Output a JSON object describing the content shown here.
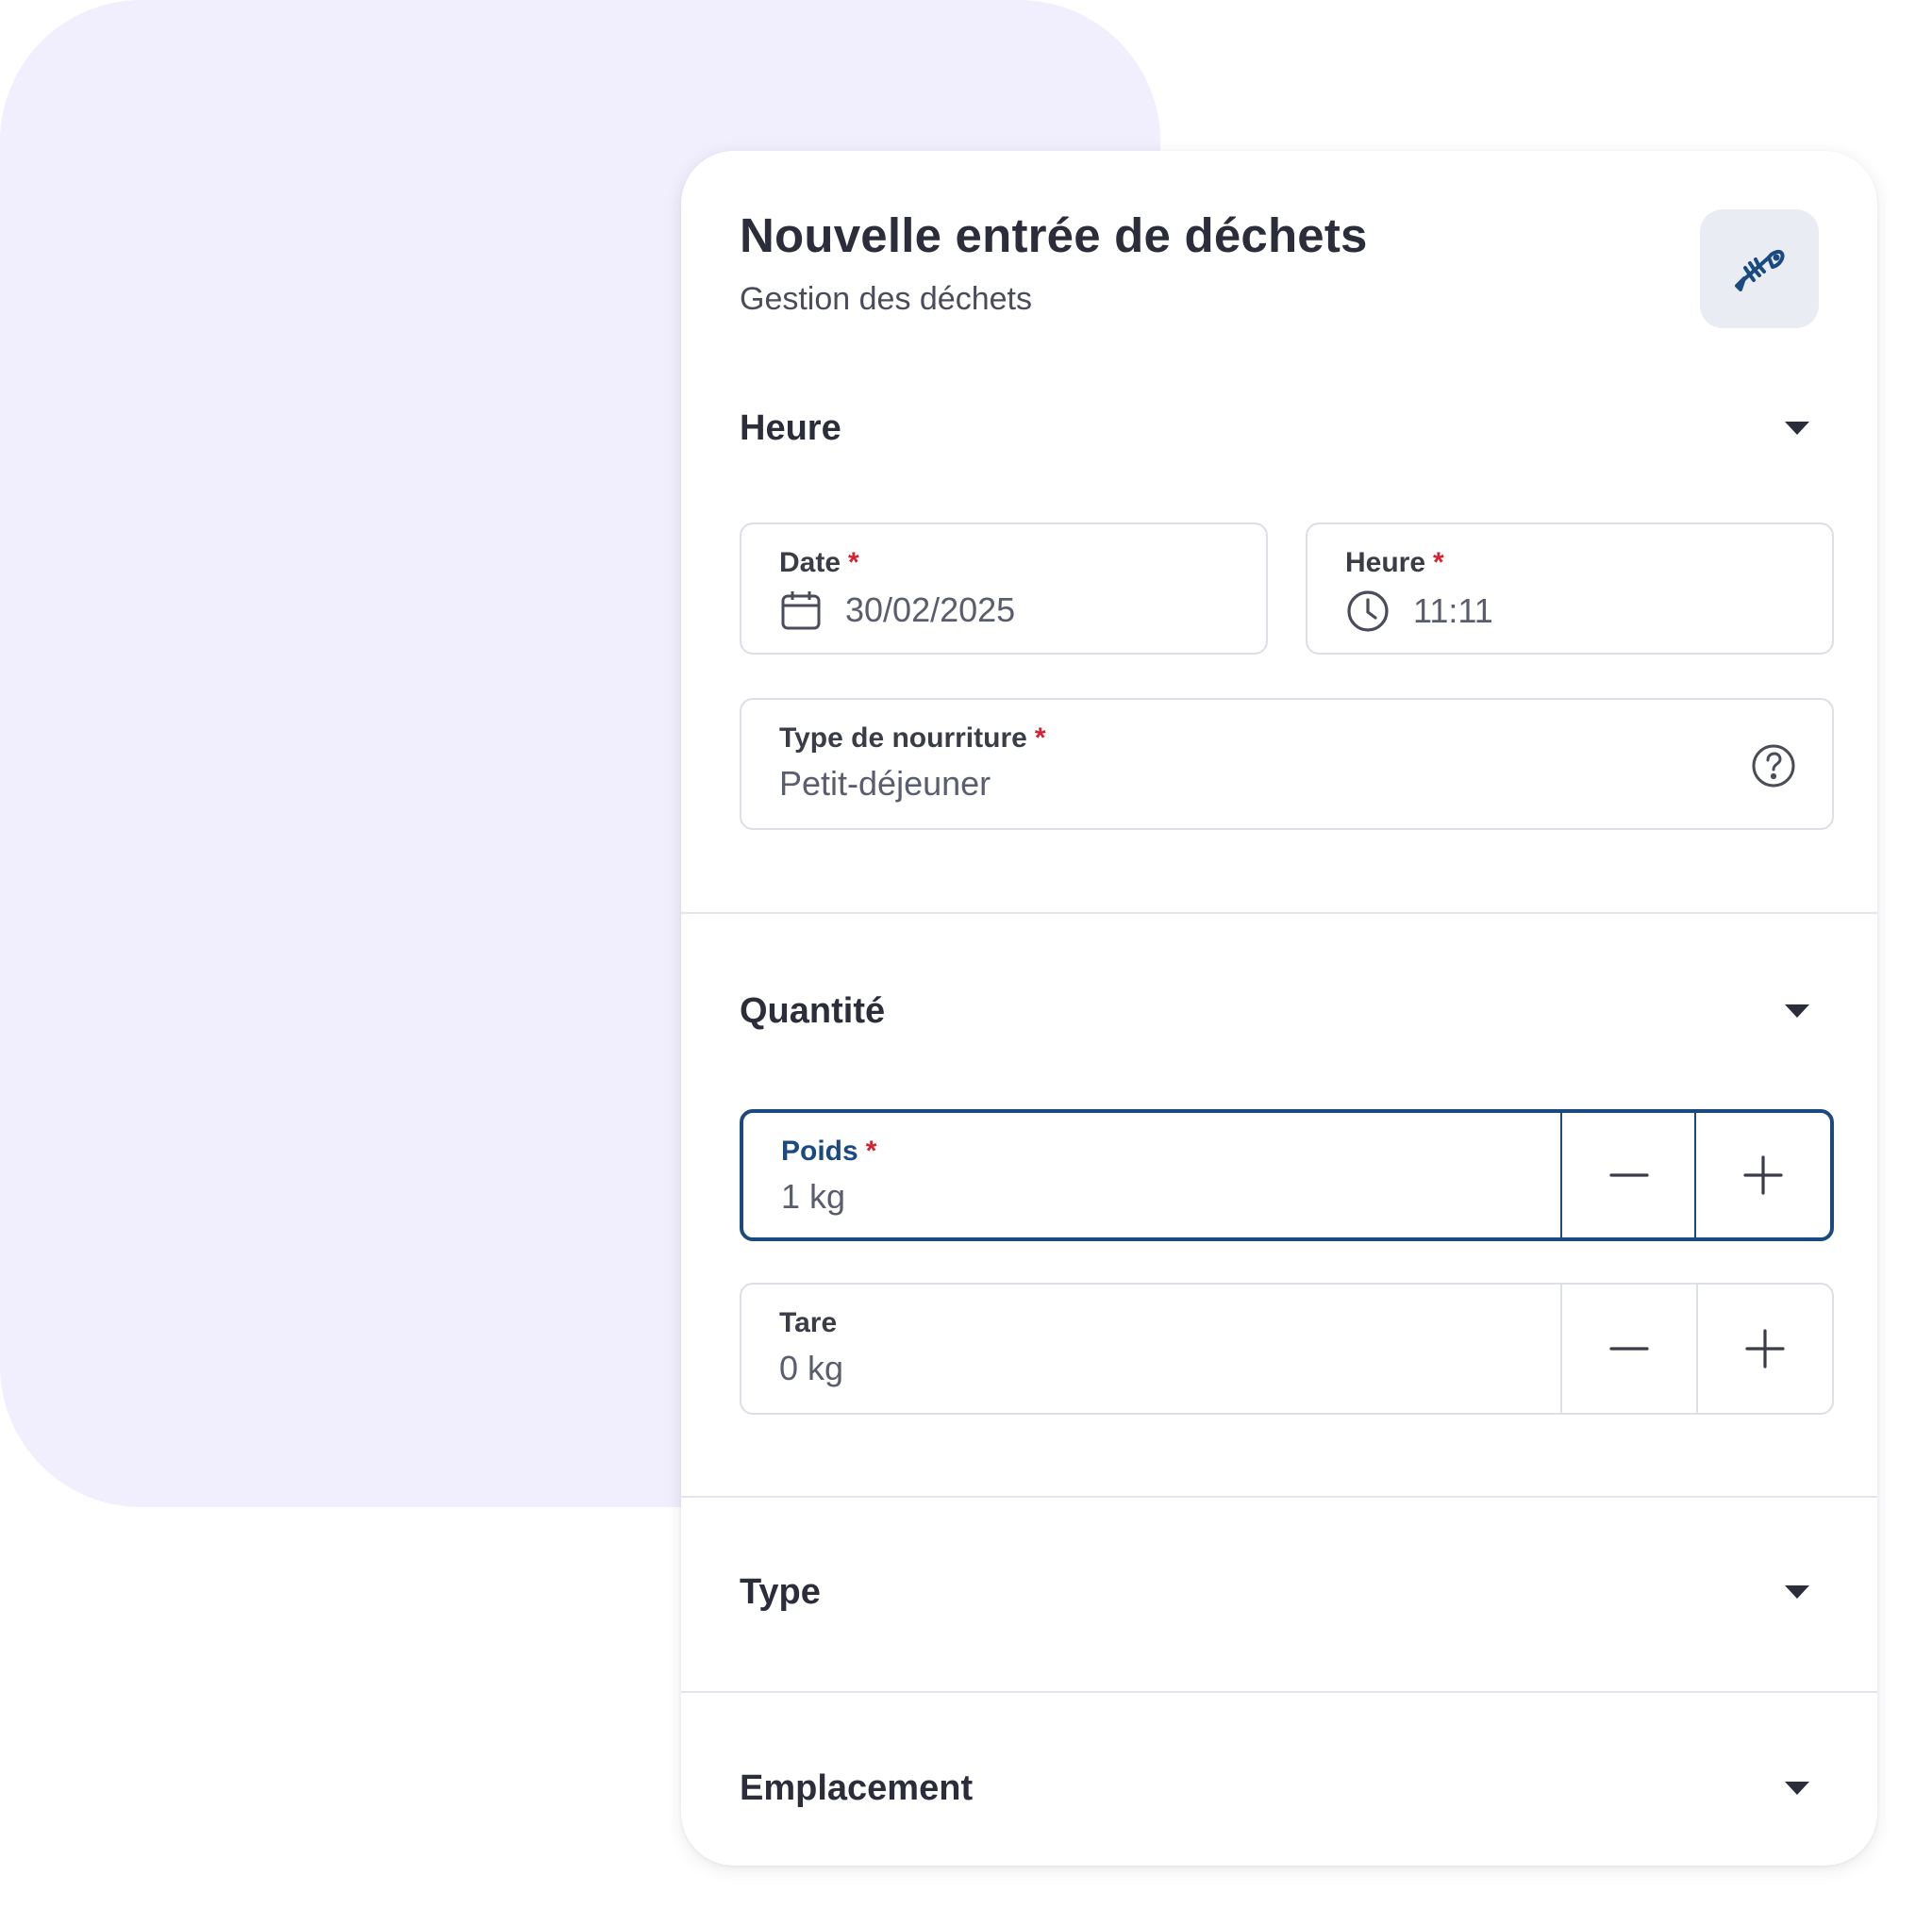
{
  "header": {
    "title": "Nouvelle entrée de déchets",
    "subtitle": "Gestion des déchets",
    "icon": "fish-bone-icon"
  },
  "sections": {
    "heure": {
      "title": "Heure"
    },
    "quantite": {
      "title": "Quantité"
    },
    "type": {
      "title": "Type"
    },
    "emplacement": {
      "title": "Emplacement"
    }
  },
  "fields": {
    "date": {
      "label": "Date",
      "required": "*",
      "value": "30/02/2025",
      "icon": "calendar-icon"
    },
    "heure": {
      "label": "Heure",
      "required": "*",
      "value": "11:11",
      "icon": "clock-icon"
    },
    "type_nourriture": {
      "label": "Type de nourriture",
      "required": "*",
      "value": "Petit-déjeuner",
      "icon": "help-icon"
    },
    "poids": {
      "label": "Poids",
      "required": "*",
      "value": "1 kg"
    },
    "tare": {
      "label": "Tare",
      "value": "0 kg"
    }
  },
  "colors": {
    "accent": "#1a4a80",
    "required": "#d32331",
    "background_blob": "#f1eefd",
    "icon_tile": "#e9edf3"
  }
}
